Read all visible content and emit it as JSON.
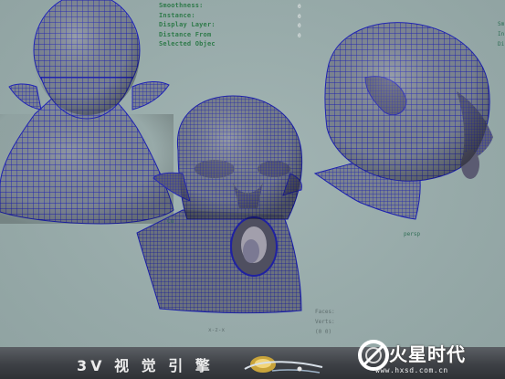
{
  "hud": {
    "lines": [
      "Smoothness:",
      "Instance:",
      "Display Layer:",
      "Distance From",
      "Selected Objec"
    ],
    "values": [
      "0",
      "0",
      "0",
      "0",
      "0"
    ]
  },
  "viewport_labels": {
    "persp": "persp",
    "bottom_center_code": "x-z-x",
    "hud_right_1": "Faces:",
    "hud_right_2": "Verts:",
    "hud_right_3": "(0 0)",
    "left_marker": "Cu",
    "right_edge": [
      "Sm",
      "In",
      "Di"
    ]
  },
  "banner": {
    "brand": "3V 视 觉 引 擎",
    "watermark_title": "火星时代",
    "watermark_url": "www.hxsd.com.cn"
  },
  "colors": {
    "background": "#97aaa9",
    "wire": "#1a18b4",
    "skin": "#858d98",
    "banner": "#3d4045"
  },
  "icons": [
    "planet-logo-icon",
    "hxsd-ring-logo-icon"
  ]
}
